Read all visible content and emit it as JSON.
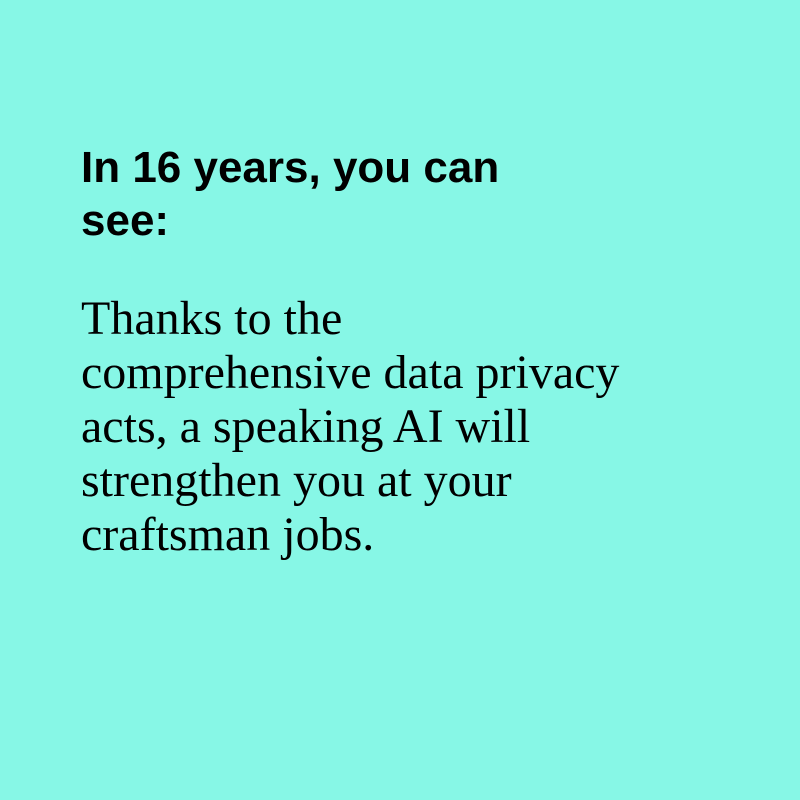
{
  "background_color": "#87F7E6",
  "text_color": "#000000",
  "heading": {
    "lines": [
      "In 16 years, you can",
      "see:"
    ]
  },
  "body": {
    "lines": [
      "Thanks to the",
      "comprehensive data privacy",
      "acts, a speaking AI will",
      "strengthen you at your",
      "craftsman jobs."
    ]
  }
}
